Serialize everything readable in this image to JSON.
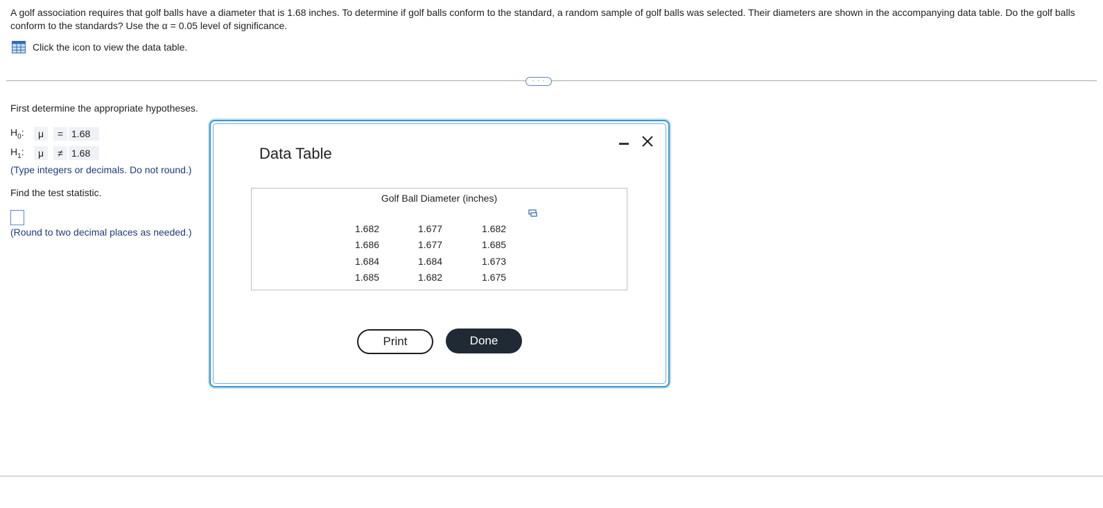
{
  "question": {
    "text": "A golf association requires that golf balls have a diameter that is 1.68 inches. To determine if golf balls conform to the standard, a random sample of golf balls was selected. Their diameters are shown in the accompanying data table. Do the golf balls conform to the standards? Use the α = 0.05 level of significance.",
    "table_link_label": "Click the icon to view the data table.",
    "more_label": "· · ·"
  },
  "left": {
    "hypotheses_prompt": "First determine the appropriate hypotheses.",
    "h0": {
      "label_main": "H",
      "label_sub": "0",
      "colon": ":",
      "param": "μ",
      "op": "=",
      "value": "1.68"
    },
    "h1": {
      "label_main": "H",
      "label_sub": "1",
      "colon": ":",
      "param": "μ",
      "op": "≠",
      "value": "1.68"
    },
    "hyp_note": "(Type integers or decimals. Do not round.)",
    "statistic_prompt": "Find the test statistic.",
    "statistic_value": "",
    "round_note": "(Round to two decimal places as needed.)"
  },
  "dialog": {
    "title": "Data Table",
    "caption": "Golf Ball Diameter (inches)",
    "rows": [
      [
        "1.682",
        "1.677",
        "1.682"
      ],
      [
        "1.686",
        "1.677",
        "1.685"
      ],
      [
        "1.684",
        "1.684",
        "1.673"
      ],
      [
        "1.685",
        "1.682",
        "1.675"
      ]
    ],
    "print_label": "Print",
    "done_label": "Done"
  },
  "icons": [
    "table-grid-icon",
    "minimize-icon",
    "close-icon",
    "copy-icon"
  ],
  "colors": {
    "dialog_border": "#3d95cf",
    "done_bg": "#1f2a35",
    "link_blue": "#1e3b7a"
  }
}
